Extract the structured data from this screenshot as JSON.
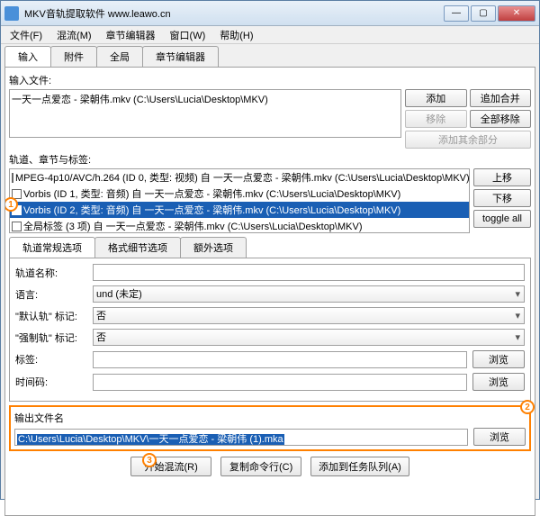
{
  "window": {
    "title": "MKV音轨提取软件 www.leawo.cn"
  },
  "menu": [
    "文件(F)",
    "混流(M)",
    "章节编辑器",
    "窗口(W)",
    "帮助(H)"
  ],
  "main_tabs": [
    "输入",
    "附件",
    "全局",
    "章节编辑器"
  ],
  "input_section": {
    "label": "输入文件:",
    "file": "一天一点爱恋 - 梁朝伟.mkv (C:\\Users\\Lucia\\Desktop\\MKV)",
    "btn_add": "添加",
    "btn_append": "追加合并",
    "btn_remove": "移除",
    "btn_remove_all": "全部移除",
    "btn_add_other": "添加其余部分"
  },
  "tracks_section": {
    "label": "轨道、章节与标签:",
    "rows": [
      {
        "checked": false,
        "text": "MPEG-4p10/AVC/h.264 (ID 0, 类型: 视频) 自 一天一点爱恋 - 梁朝伟.mkv (C:\\Users\\Lucia\\Desktop\\MKV)"
      },
      {
        "checked": false,
        "text": "Vorbis (ID 1, 类型: 音频) 自 一天一点爱恋 - 梁朝伟.mkv (C:\\Users\\Lucia\\Desktop\\MKV)"
      },
      {
        "checked": true,
        "text": "Vorbis (ID 2, 类型: 音频) 自 一天一点爱恋 - 梁朝伟.mkv (C:\\Users\\Lucia\\Desktop\\MKV)"
      },
      {
        "checked": false,
        "text": "全局标签 (3 项) 自 一天一点爱恋 - 梁朝伟.mkv (C:\\Users\\Lucia\\Desktop\\MKV)"
      }
    ],
    "btn_up": "上移",
    "btn_down": "下移",
    "btn_toggle": "toggle all"
  },
  "sub_tabs": [
    "轨道常规选项",
    "格式细节选项",
    "额外选项"
  ],
  "form": {
    "track_name_label": "轨道名称:",
    "lang_label": "语言:",
    "lang_value": "und (未定)",
    "default_label": "\"默认轨\" 标记:",
    "default_value": "否",
    "forced_label": "\"强制轨\" 标记:",
    "forced_value": "否",
    "tags_label": "标签:",
    "timecode_label": "时间码:",
    "browse": "浏览"
  },
  "output": {
    "label": "输出文件名",
    "value": "C:\\Users\\Lucia\\Desktop\\MKV\\一天一点爱恋 - 梁朝伟 (1).mka",
    "browse": "浏览"
  },
  "bottom": {
    "start": "开始混流(R)",
    "copy_cmd": "复制命令行(C)",
    "add_queue": "添加到任务队列(A)"
  },
  "annotations": {
    "a1": "1",
    "a2": "2",
    "a3": "3"
  }
}
